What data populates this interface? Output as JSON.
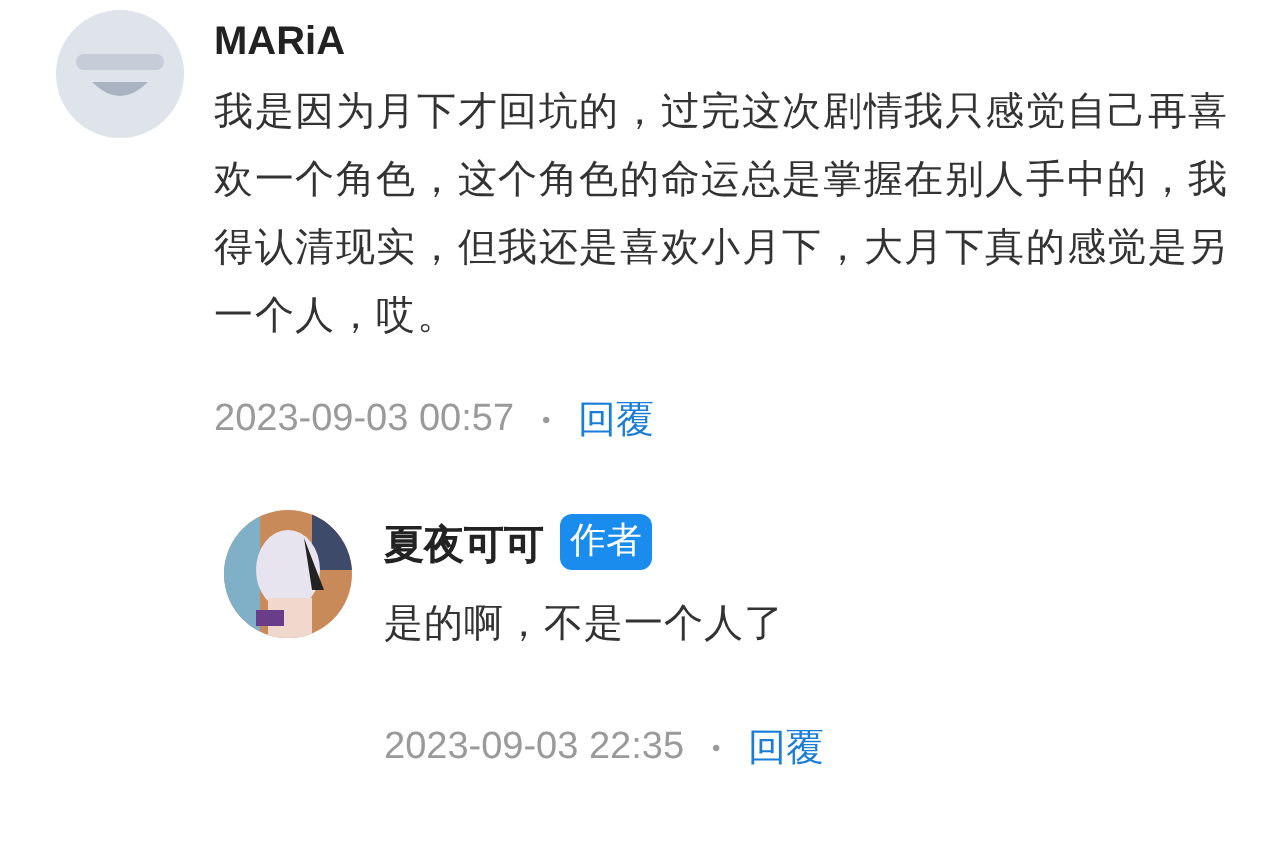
{
  "comment": {
    "author": "MARiA",
    "text": "我是因为月下才回坑的，过完这次剧情我只感觉自己再喜欢一个角色，这个角色的命运总是掌握在别人手中的，我得认清现实，但我还是喜欢小月下，大月下真的感觉是另一个人，哎。",
    "time": "2023-09-03 00:57",
    "separator": "•",
    "reply_link": "回覆"
  },
  "reply": {
    "author": "夏夜可可",
    "badge": "作者",
    "text": "是的啊，不是一个人了",
    "time": "2023-09-03 22:35",
    "separator": "•",
    "reply_link": "回覆"
  }
}
